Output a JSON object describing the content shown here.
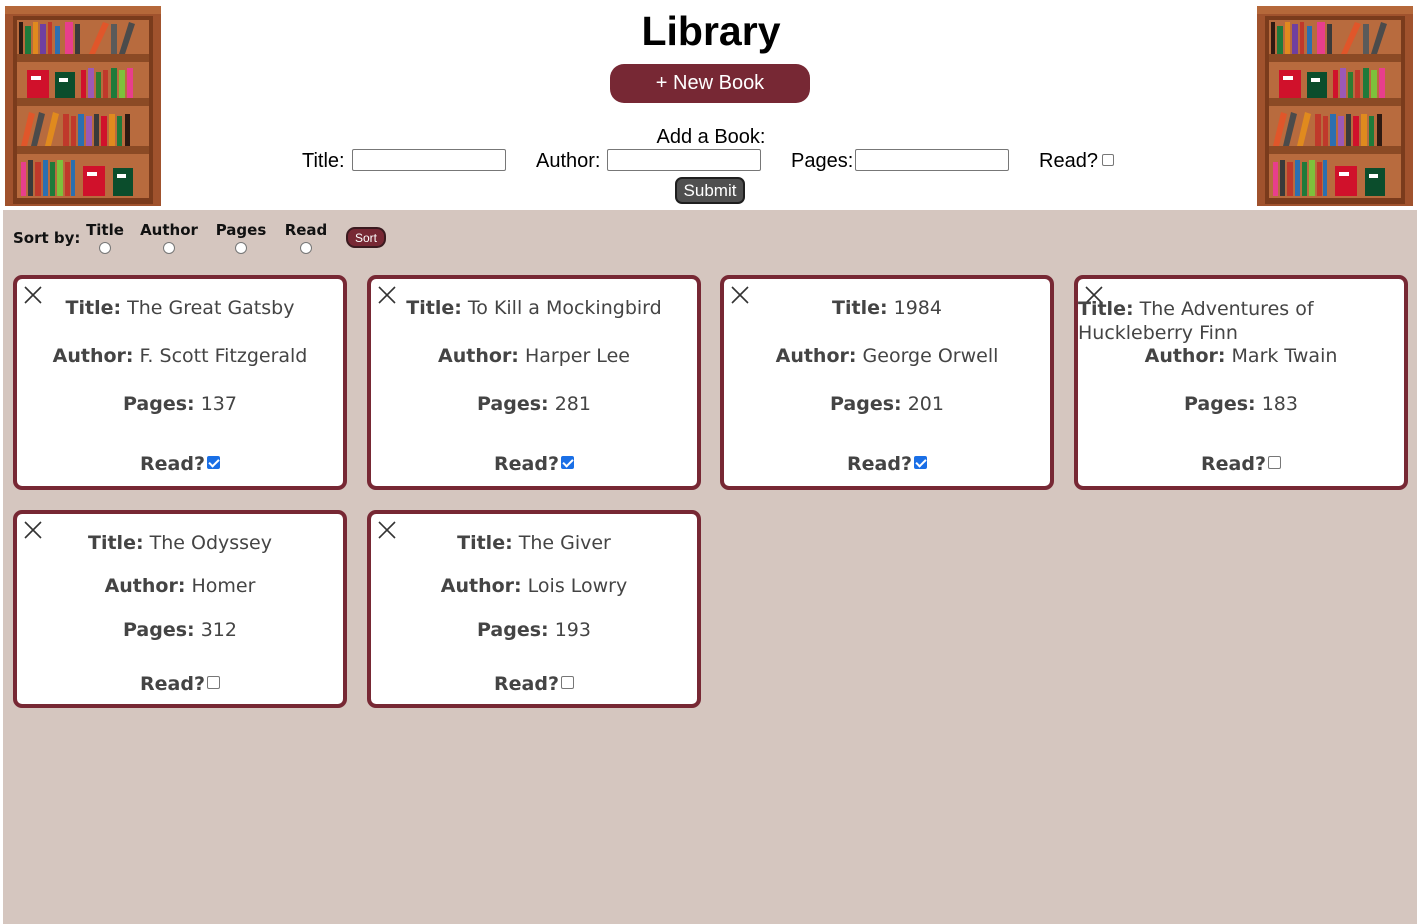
{
  "header": {
    "title": "Library",
    "new_book_label": "+ New Book",
    "form": {
      "heading": "Add a Book:",
      "title_label": "Title:",
      "title_value": "",
      "author_label": "Author:",
      "author_value": "",
      "pages_label": "Pages:",
      "pages_value": "",
      "read_label": "Read?",
      "read_checked": false,
      "submit_label": "Submit"
    }
  },
  "sort": {
    "label": "Sort by:",
    "options": [
      "Title",
      "Author",
      "Pages",
      "Read"
    ],
    "button_label": "Sort"
  },
  "field_labels": {
    "title": "Title:",
    "author": "Author:",
    "pages": "Pages:",
    "read": "Read?"
  },
  "books": [
    {
      "title": "The Great Gatsby",
      "author": "F. Scott Fitzgerald",
      "pages": "137",
      "read": true
    },
    {
      "title": "To Kill a Mockingbird",
      "author": "Harper Lee",
      "pages": "281",
      "read": true
    },
    {
      "title": "1984",
      "author": "George Orwell",
      "pages": "201",
      "read": true
    },
    {
      "title": "The Adventures of Huckleberry Finn",
      "author": "Mark Twain",
      "pages": "183",
      "read": false
    },
    {
      "title": "The Odyssey",
      "author": "Homer",
      "pages": "312",
      "read": false
    },
    {
      "title": "The Giver",
      "author": "Lois Lowry",
      "pages": "193",
      "read": false
    }
  ],
  "colors": {
    "accent": "#772834",
    "background": "#d5c6bf",
    "checkbox_checked": "#1a6fe6"
  },
  "icons": {
    "shelf": "bookshelf-icon",
    "remove": "close-icon"
  }
}
